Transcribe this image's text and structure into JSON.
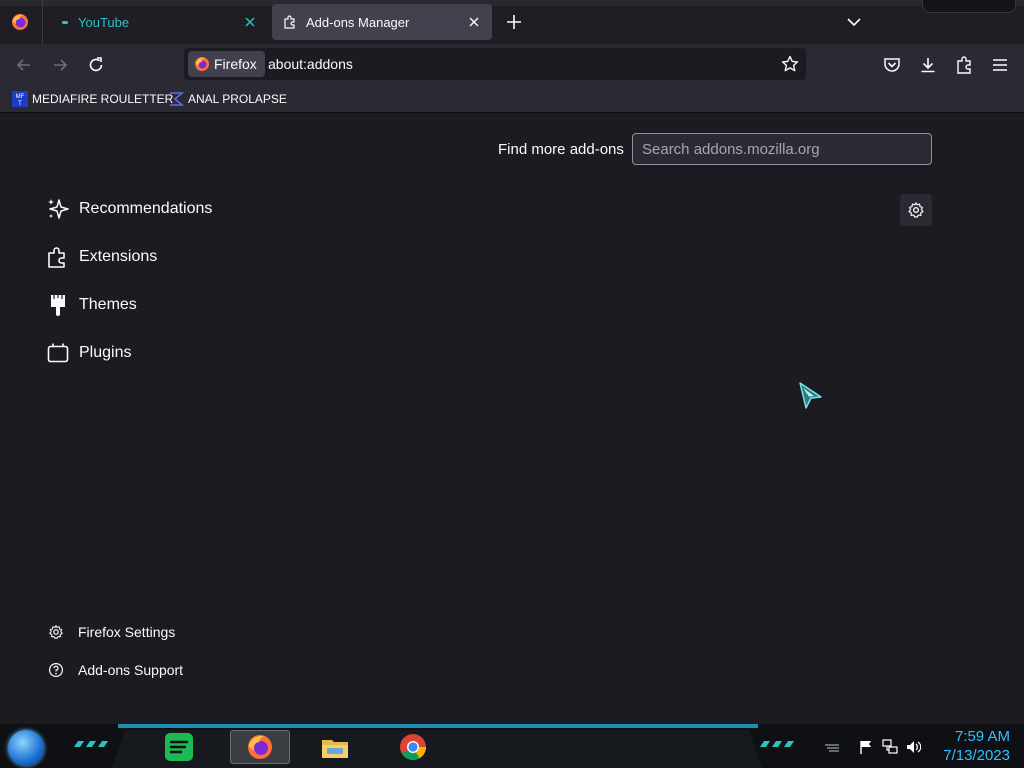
{
  "tabs": [
    {
      "label": "YouTube",
      "active": false
    },
    {
      "label": "Add-ons Manager",
      "active": true
    }
  ],
  "urlbar": {
    "identity_label": "Firefox",
    "url": "about:addons"
  },
  "bookmarks": [
    {
      "label": "MEDIAFIRE ROULETTER",
      "icon": "mediafire-icon"
    },
    {
      "label": "ANAL PROLAPSE",
      "icon": "sigma-icon"
    }
  ],
  "addons": {
    "find_more_label": "Find more add-ons",
    "search_placeholder": "Search addons.mozilla.org",
    "categories": [
      {
        "label": "Recommendations",
        "icon": "sparkles-icon"
      },
      {
        "label": "Extensions",
        "icon": "puzzle-icon"
      },
      {
        "label": "Themes",
        "icon": "brush-icon"
      },
      {
        "label": "Plugins",
        "icon": "plugin-icon"
      }
    ],
    "footer": [
      {
        "label": "Firefox Settings",
        "icon": "gear-icon"
      },
      {
        "label": "Add-ons Support",
        "icon": "help-icon"
      }
    ]
  },
  "taskbar": {
    "apps": [
      "spotify-icon",
      "firefox-icon",
      "file-explorer-icon",
      "chrome-icon"
    ],
    "clock_time": "7:59 AM",
    "clock_date": "7/13/2023"
  },
  "colors": {
    "accent": "#2ac3c6",
    "page_bg": "#1c1b22",
    "toolbar_bg": "#2b2a33",
    "clock": "#2fc1ff"
  }
}
